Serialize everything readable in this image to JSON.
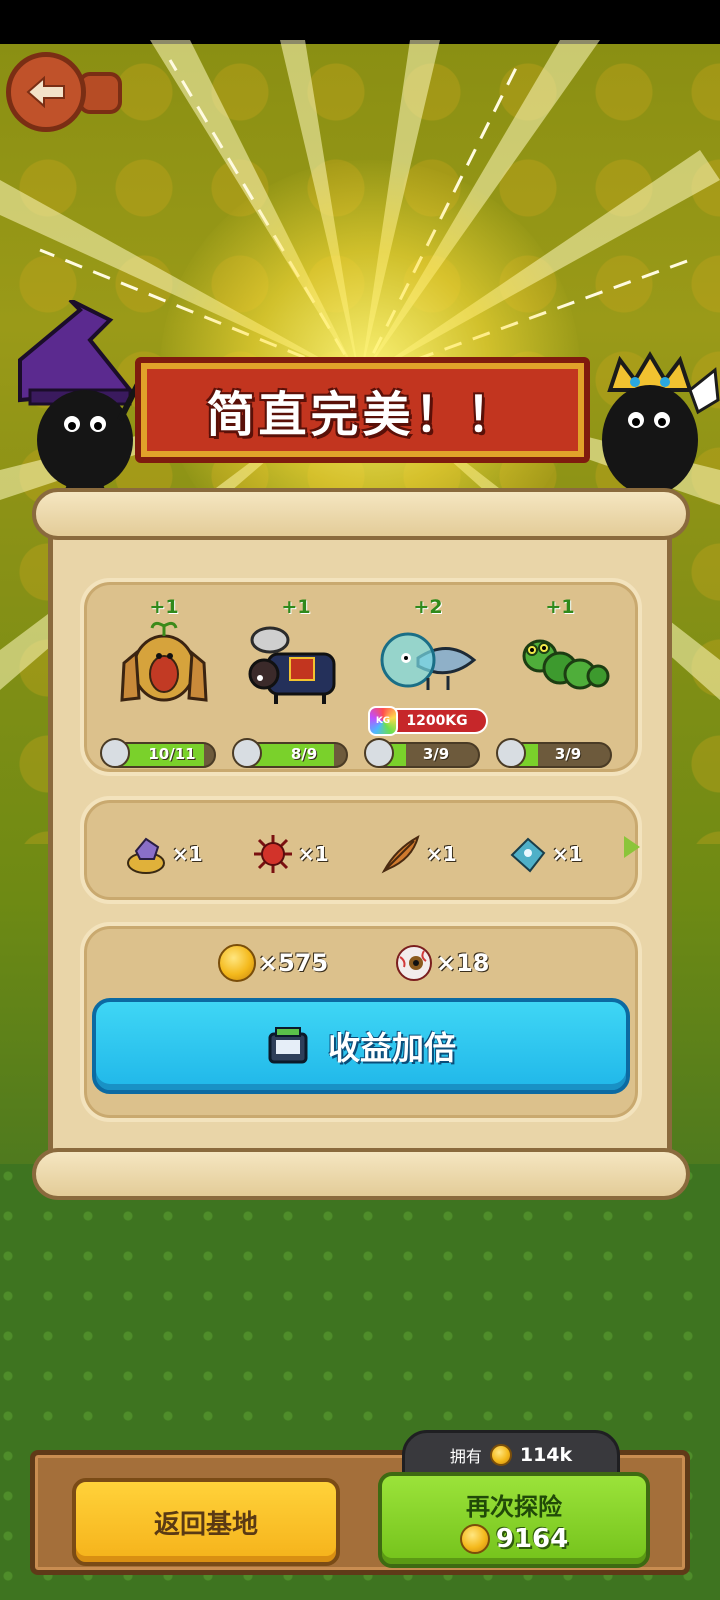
{
  "banner": {
    "title": "简直完美！！"
  },
  "monsters": [
    {
      "name_icon": "monkey-creature-icon",
      "plus": "+1",
      "count": "10/11",
      "progress": 0.91
    },
    {
      "name_icon": "chainsaw-boar-icon",
      "plus": "+1",
      "count": "8/9",
      "progress": 0.89
    },
    {
      "name_icon": "fish-in-bubble-icon",
      "plus": "+2",
      "count": "3/9",
      "progress": 0.33,
      "weight_badge": "KG",
      "weight": "1200KG"
    },
    {
      "name_icon": "caterpillar-icon",
      "plus": "+1",
      "count": "3/9",
      "progress": 0.33
    }
  ],
  "items": [
    {
      "icon": "treasure-gem-icon",
      "count": "×1"
    },
    {
      "icon": "red-urchin-icon",
      "count": "×1"
    },
    {
      "icon": "feather-icon",
      "count": "×1"
    },
    {
      "icon": "blue-crystal-icon",
      "count": "×1"
    }
  ],
  "rewards": {
    "coins": "×575",
    "eyeballs": "×18"
  },
  "double_button": {
    "label": "收益加倍",
    "icon": "tv-ad-icon"
  },
  "owned": {
    "label": "拥有",
    "value": "114k"
  },
  "return_button": {
    "label": "返回基地"
  },
  "explore_button": {
    "label": "再次探险",
    "cost": "9164"
  },
  "colors": {
    "banner_red": "#c2351f",
    "double_button": "#20b7e9",
    "return_button": "#f5b21a",
    "explore_button": "#74c21b",
    "progress_green": "#7ad12b"
  }
}
